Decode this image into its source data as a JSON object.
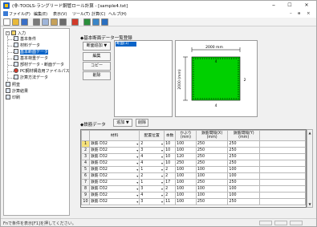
{
  "window": {
    "title": "(非-TOOLS-ラングリード鋼管ロール計算 - [sample4.txt]",
    "minimize": "–",
    "maximize": "☐",
    "close": "✕"
  },
  "menu": {
    "items": [
      "ファイル(F)",
      "編集(E)",
      "表示(V)",
      "ツール(T)",
      "計算(C)",
      "ヘルプ(H)"
    ],
    "mdi": [
      "–",
      "ɵ",
      "×"
    ]
  },
  "toolbar": {
    "buttons": [
      {
        "name": "new-icon",
        "color": "#ffffff"
      },
      {
        "name": "open-icon",
        "color": "#e8b93a"
      },
      {
        "name": "save-icon",
        "color": "#3a6fc7"
      },
      {
        "name": "cut-icon",
        "color": "#7a7a7a"
      },
      {
        "name": "copy-icon",
        "color": "#9fb5d9"
      },
      {
        "name": "paste-icon",
        "color": "#c6a15a"
      },
      {
        "name": "print-icon",
        "color": "#6b6b6b"
      },
      {
        "name": "run-icon",
        "color": "#d23a2a"
      },
      {
        "name": "calc-icon",
        "color": "#2a8f3b"
      },
      {
        "name": "table-icon",
        "color": "#3a86c8"
      },
      {
        "name": "help-icon",
        "color": "#2a6fc0"
      }
    ]
  },
  "tree": {
    "root": "入力",
    "items": [
      {
        "label": "基本条件",
        "selected": false
      },
      {
        "label": "材料データ",
        "selected": false
      },
      {
        "label": "基本断面データ",
        "selected": true
      },
      {
        "label": "基本荷重データ",
        "selected": false
      },
      {
        "label": "部材データ・断面データ",
        "selected": false
      },
      {
        "label": "PC鋼材構造用ファイルパス",
        "selected": false
      },
      {
        "label": "計算方法データ",
        "selected": false
      }
    ],
    "others": [
      "照査",
      "計算結果",
      "印刷"
    ]
  },
  "section": {
    "header": "◆基本断面データ一覧登録",
    "list_button": "断面追加 ▼",
    "edit_button": "編集",
    "copy_button": "コピー",
    "delete_button": "削除",
    "list_selected": "断面(1)"
  },
  "drawing": {
    "width_label": "2000 mm",
    "height_label": "2000 (mm)",
    "top_label": "4",
    "bottom_label": "4",
    "side_label": "2",
    "fill_color": "#00d000",
    "rebar_color": "#000000"
  },
  "rebar": {
    "header": "◆鉄筋データ",
    "add_button": "追加 ▼",
    "delete_button": "削除",
    "columns": [
      "材料",
      "配置位置",
      "本数",
      "かぶり\n(mm)",
      "鉄筋間隔(X)\n(mm)",
      "鉄筋間隔(Y)\n(mm)"
    ],
    "rows": [
      [
        "1",
        "鉄筋 D32",
        "2",
        "10",
        "100",
        "250",
        "250"
      ],
      [
        "2",
        "鉄筋 D32",
        "3",
        "10",
        "100",
        "250",
        "250"
      ],
      [
        "3",
        "鉄筋 D32",
        "4",
        "10",
        "120",
        "250",
        "250"
      ],
      [
        "4",
        "鉄筋 D32",
        "4",
        "10",
        "250",
        "250",
        "250"
      ],
      [
        "5",
        "鉄筋 D32",
        "1",
        "2",
        "100",
        "100",
        "100"
      ],
      [
        "6",
        "鉄筋 D32",
        "2",
        "2",
        "100",
        "100",
        "100"
      ],
      [
        "7",
        "鉄筋 D32",
        "1",
        "17",
        "100",
        "250",
        "250"
      ],
      [
        "8",
        "鉄筋 D32",
        "3",
        "2",
        "100",
        "100",
        "100"
      ],
      [
        "9",
        "鉄筋 D32",
        "4",
        "2",
        "100",
        "100",
        "100"
      ],
      [
        "10",
        "鉄筋 D32",
        "3",
        "11",
        "100",
        "250",
        "250"
      ]
    ],
    "selected_row": "1"
  },
  "status": {
    "text": "Fnで条件を表示[F1]を押してください。"
  },
  "colors": {
    "selection": "#0a64c8",
    "row_highlight": "#f6e27b"
  }
}
